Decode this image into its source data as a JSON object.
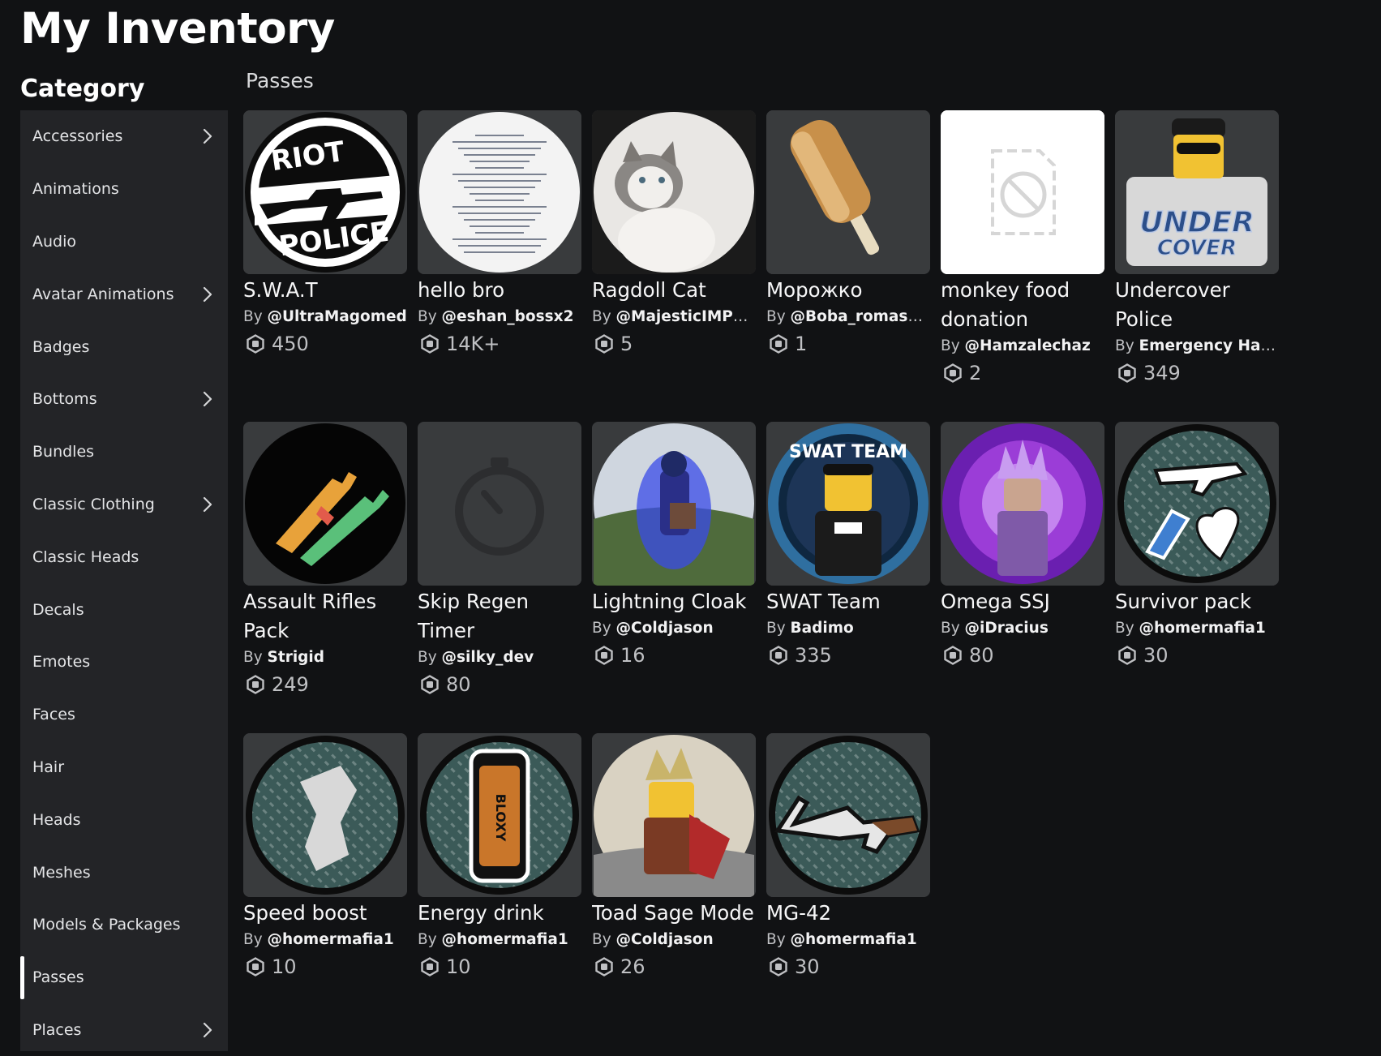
{
  "page_title": "My Inventory",
  "category_heading": "Category",
  "section_title": "Passes",
  "creator_prefix": "By",
  "colors": {
    "background": "#111214",
    "sidebar": "#232427",
    "card_thumb": "#393b3d",
    "text_primary": "#f7f7f8",
    "text_secondary": "#bfc0c3"
  },
  "categories": [
    {
      "label": "Accessories",
      "has_submenu": true,
      "active": false
    },
    {
      "label": "Animations",
      "has_submenu": false,
      "active": false
    },
    {
      "label": "Audio",
      "has_submenu": false,
      "active": false
    },
    {
      "label": "Avatar Animations",
      "has_submenu": true,
      "active": false
    },
    {
      "label": "Badges",
      "has_submenu": false,
      "active": false
    },
    {
      "label": "Bottoms",
      "has_submenu": true,
      "active": false
    },
    {
      "label": "Bundles",
      "has_submenu": false,
      "active": false
    },
    {
      "label": "Classic Clothing",
      "has_submenu": true,
      "active": false
    },
    {
      "label": "Classic Heads",
      "has_submenu": false,
      "active": false
    },
    {
      "label": "Decals",
      "has_submenu": false,
      "active": false
    },
    {
      "label": "Emotes",
      "has_submenu": false,
      "active": false
    },
    {
      "label": "Faces",
      "has_submenu": false,
      "active": false
    },
    {
      "label": "Hair",
      "has_submenu": false,
      "active": false
    },
    {
      "label": "Heads",
      "has_submenu": false,
      "active": false
    },
    {
      "label": "Meshes",
      "has_submenu": false,
      "active": false
    },
    {
      "label": "Models & Packages",
      "has_submenu": false,
      "active": false
    },
    {
      "label": "Passes",
      "has_submenu": false,
      "active": true
    },
    {
      "label": "Places",
      "has_submenu": true,
      "active": false
    }
  ],
  "items": [
    {
      "name": "S.W.A.T",
      "creator": "@UltraMagomed",
      "price": "450",
      "thumb": "riot-police-icon"
    },
    {
      "name": "hello bro",
      "creator": "@eshan_bossx2",
      "price": "14K+",
      "thumb": "document-icon"
    },
    {
      "name": "Ragdoll Cat",
      "creator": "@MajesticIMPRO...",
      "price": "5",
      "thumb": "cat-icon"
    },
    {
      "name": "Морожко",
      "creator": "@Boba_romashka",
      "price": "1",
      "thumb": "popsicle-icon"
    },
    {
      "name": "monkey food donation",
      "creator": "@Hamzalechaz",
      "price": "2",
      "thumb": "unavailable-image-icon"
    },
    {
      "name": "Undercover Police",
      "creator": "Emergency Ham...",
      "price": "349",
      "thumb": "undercover-icon"
    },
    {
      "name": "Assault Rifles Pack",
      "creator": "Strigid",
      "price": "249",
      "thumb": "rifles-icon"
    },
    {
      "name": "Skip Regen Timer",
      "creator": "@silky_dev",
      "price": "80",
      "thumb": "stopwatch-icon"
    },
    {
      "name": "Lightning Cloak",
      "creator": "@Coldjason",
      "price": "16",
      "thumb": "lightning-avatar-icon"
    },
    {
      "name": "SWAT Team",
      "creator": "Badimo",
      "price": "335",
      "thumb": "swat-team-icon"
    },
    {
      "name": "Omega SSJ",
      "creator": "@iDracius",
      "price": "80",
      "thumb": "omega-avatar-icon"
    },
    {
      "name": "Survivor pack",
      "creator": "@homermafia1",
      "price": "30",
      "thumb": "survivor-pack-icon"
    },
    {
      "name": "Speed boost",
      "creator": "@homermafia1",
      "price": "10",
      "thumb": "speed-boost-icon"
    },
    {
      "name": "Energy drink",
      "creator": "@homermafia1",
      "price": "10",
      "thumb": "energy-drink-icon"
    },
    {
      "name": "Toad Sage Mode",
      "creator": "@Coldjason",
      "price": "26",
      "thumb": "toad-sage-avatar-icon"
    },
    {
      "name": "MG-42",
      "creator": "@homermafia1",
      "price": "30",
      "thumb": "machine-gun-icon"
    }
  ]
}
